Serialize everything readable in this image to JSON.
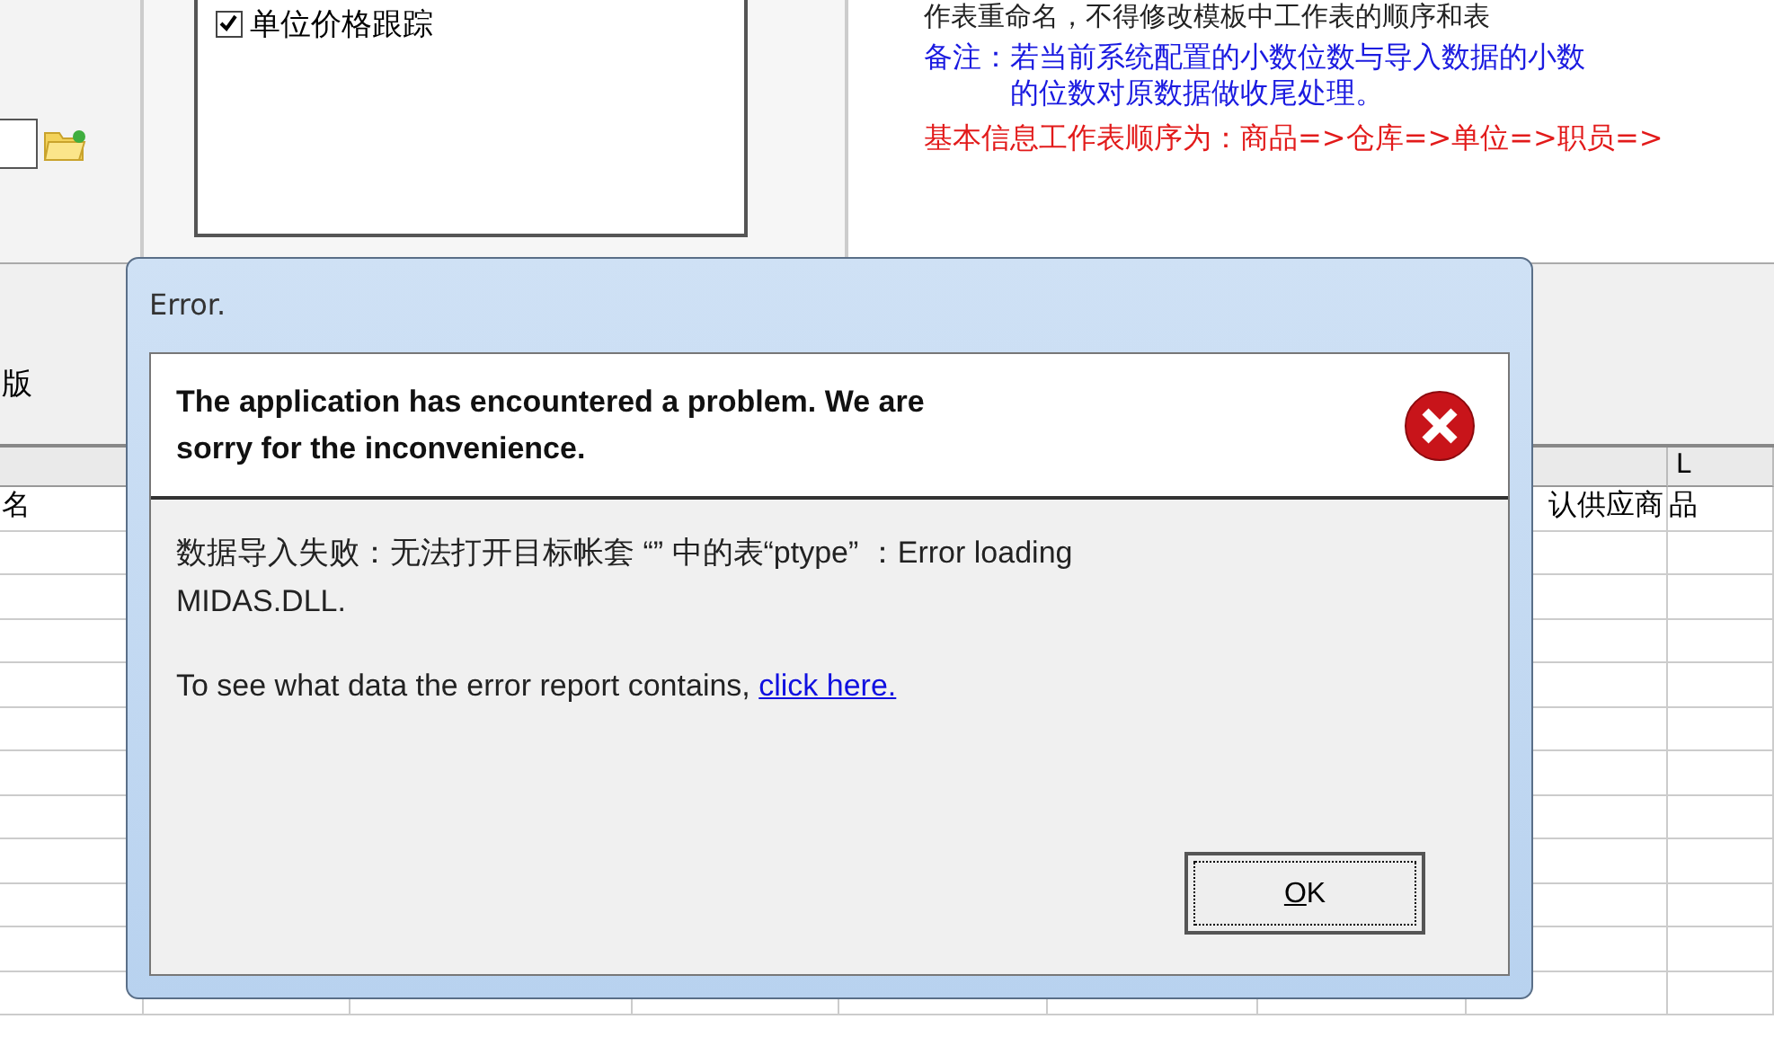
{
  "options_list": {
    "items": [
      {
        "label": "单位价格跟踪",
        "checked": true
      }
    ]
  },
  "notes": [
    {
      "kind": "plain",
      "text": "作表重命名，不得修改模板中工作表的顺序和表"
    },
    {
      "kind": "remark",
      "label": "备注：",
      "text": "若当前系统配置的小数位数与导入数据的小数",
      "continuation": "的位数对原数据做收尾处理。"
    },
    {
      "kind": "order",
      "text": "基本信息工作表顺序为：商品=>仓库=>单位=>职员=>"
    }
  ],
  "toolbar_label": "版",
  "sheet": {
    "header_label": "L",
    "first_row": {
      "first": "名",
      "eighth": "认供应商",
      "ninth": "品"
    }
  },
  "dialog": {
    "title": "Error.",
    "headline": "The application has encountered a problem. We are sorry for the inconvenience.",
    "message": "数据导入失败：无法打开目标帐套 “” 中的表“ptype” ：Error loading MIDAS.DLL.",
    "report_text": "To see what data the error report contains,",
    "report_link": "click here.",
    "button": {
      "label": "OK"
    }
  }
}
